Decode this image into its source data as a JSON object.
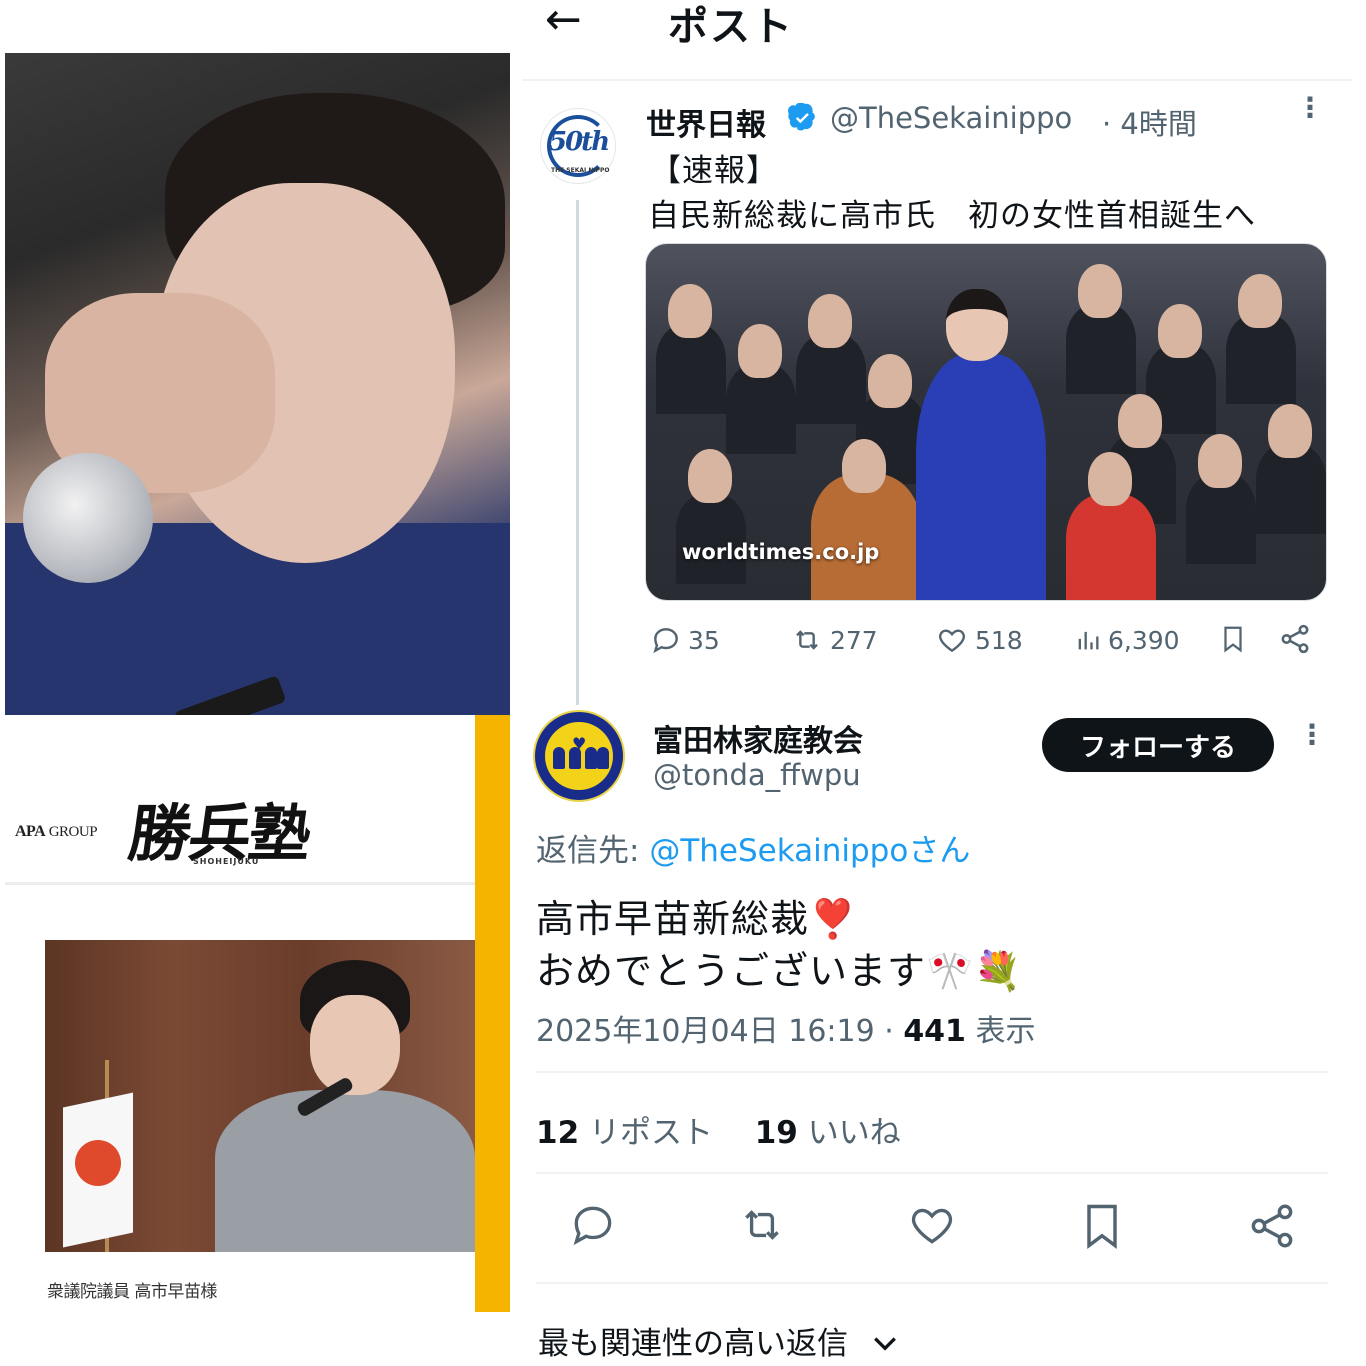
{
  "header": {
    "title": "ポスト"
  },
  "left": {
    "ad": {
      "brand": "APA",
      "group": "GROUP",
      "logo_text": "勝兵塾",
      "logo_sub": "SHOHEIJUKU",
      "caption": "衆議院議員 高市早苗様"
    }
  },
  "tweet1": {
    "avatar_text": "50th",
    "avatar_sub": "THE SEKAI NIPPO",
    "name": "世界日報",
    "handle": "@TheSekainippo",
    "time": "· 4時間",
    "line1": "【速報】",
    "line2": "自民新総裁に高市氏　初の女性首相誕生へ",
    "image_watermark": "worldtimes.co.jp",
    "stats": {
      "replies": "35",
      "reposts": "277",
      "likes": "518",
      "views": "6,390"
    }
  },
  "reply": {
    "name": "富田林家庭教会",
    "handle": "@tonda_ffwpu",
    "follow_label": "フォローする",
    "replying_label": "返信先:",
    "replying_to": "@TheSekainippoさん",
    "line1": "高市早苗新総裁❣️",
    "line2": "おめでとうございます🎌💐",
    "timestamp": "2025年10月04日 16:19 ·",
    "views_count": "441",
    "views_label": "表示",
    "reposts_count": "12",
    "reposts_label": "リポスト",
    "likes_count": "19",
    "likes_label": "いいね"
  },
  "footer": {
    "sort_label": "最も関連性の高い返信"
  },
  "colors": {
    "text": "#0f1419",
    "muted": "#536471",
    "link": "#1d9bf0",
    "verified": "#1d9bf0",
    "divider": "#eff3f4",
    "ad_stripe": "#f4b400"
  }
}
